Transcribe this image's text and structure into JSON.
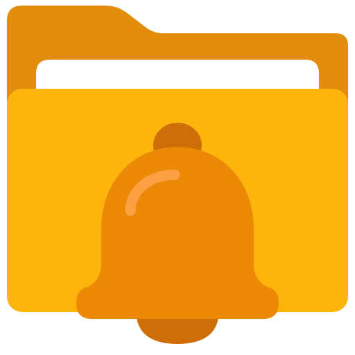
{
  "icon": {
    "name": "folder-notification-icon",
    "parts": [
      "folder-icon",
      "paper-sheet",
      "bell-icon"
    ]
  },
  "colors": {
    "folder_back": "#E38D0C",
    "paper": "#FFFFFF",
    "folder_front": "#FDB50E",
    "bell_body": "#EC8907",
    "bell_top_and_clapper": "#CD6F06",
    "bell_highlight": "#FBA043"
  }
}
